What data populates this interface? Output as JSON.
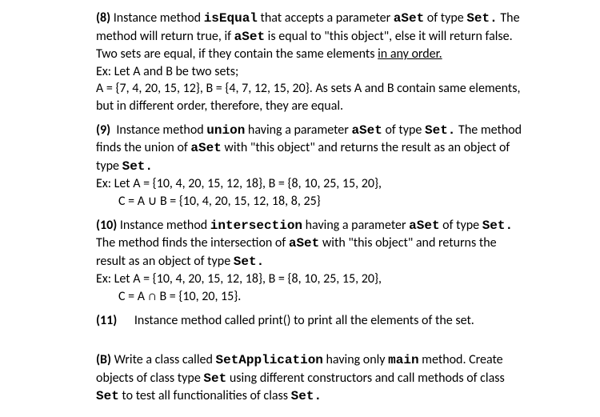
{
  "section8": {
    "label": "(8)",
    "text1a": "Instance method ",
    "method": "isEqual",
    "text1b": " that accepts a parameter ",
    "param": "aSet",
    "text1c": " of type ",
    "type": "Set.",
    "text2a": "The method will return true, if ",
    "text2b": " is equal to \"this object\", else it will return false. Two sets are equal, if they contain the same elements ",
    "underlined": "in any order.",
    "ex1": "Ex: Let A and B be two sets;",
    "ex2": "A = {7, 4, 20, 15, 12}, B = {4, 7, 12, 15, 20}. As sets A and B contain same elements, but in different order, therefore, they are equal."
  },
  "section9": {
    "label": "(9)",
    "text1a": "Instance method ",
    "method": "union",
    "text1b": " having a parameter ",
    "param": "aSet",
    "text1c": " of type ",
    "type": "Set.",
    "text2a": "The method finds the union of ",
    "text2b": " with \"this object\" and returns the result as an object of type ",
    "type2": "Set.",
    "ex1": "Ex: Let A = {10, 4, 20, 15, 12, 18}, B = {8, 10, 25, 15, 20},",
    "ex2": "C = A ∪ B = {10, 4, 20, 15, 12, 18, 8, 25}"
  },
  "section10": {
    "label": "(10)",
    "text1a": "Instance method ",
    "method": "intersection",
    "text1b": " having a parameter ",
    "param": "aSet",
    "text1c": " of type ",
    "type": "Set.",
    "text2a": "The method finds the intersection of ",
    "text2b": " with \"this object\" and returns the result as an object of type ",
    "type2": "Set.",
    "ex1": "Ex: Let A = {10, 4, 20, 15, 12, 18}, B = {8, 10, 25, 15, 20},",
    "ex2": "C = A ∩ B = {10, 20, 15}."
  },
  "section11": {
    "label": "(11)",
    "text": "Instance method called print() to print all the elements of the set."
  },
  "sectionB": {
    "label": "(B)",
    "text1a": "Write a class called ",
    "class1": "SetApplication",
    "text1b": " having only ",
    "class2": "main",
    "text1c": " method. Create objects of class type ",
    "type1": "Set",
    "text1d": " using different constructors and call methods of class ",
    "type2": "Set",
    "text1e": " to test all functionalities of class ",
    "type3": "Set."
  }
}
